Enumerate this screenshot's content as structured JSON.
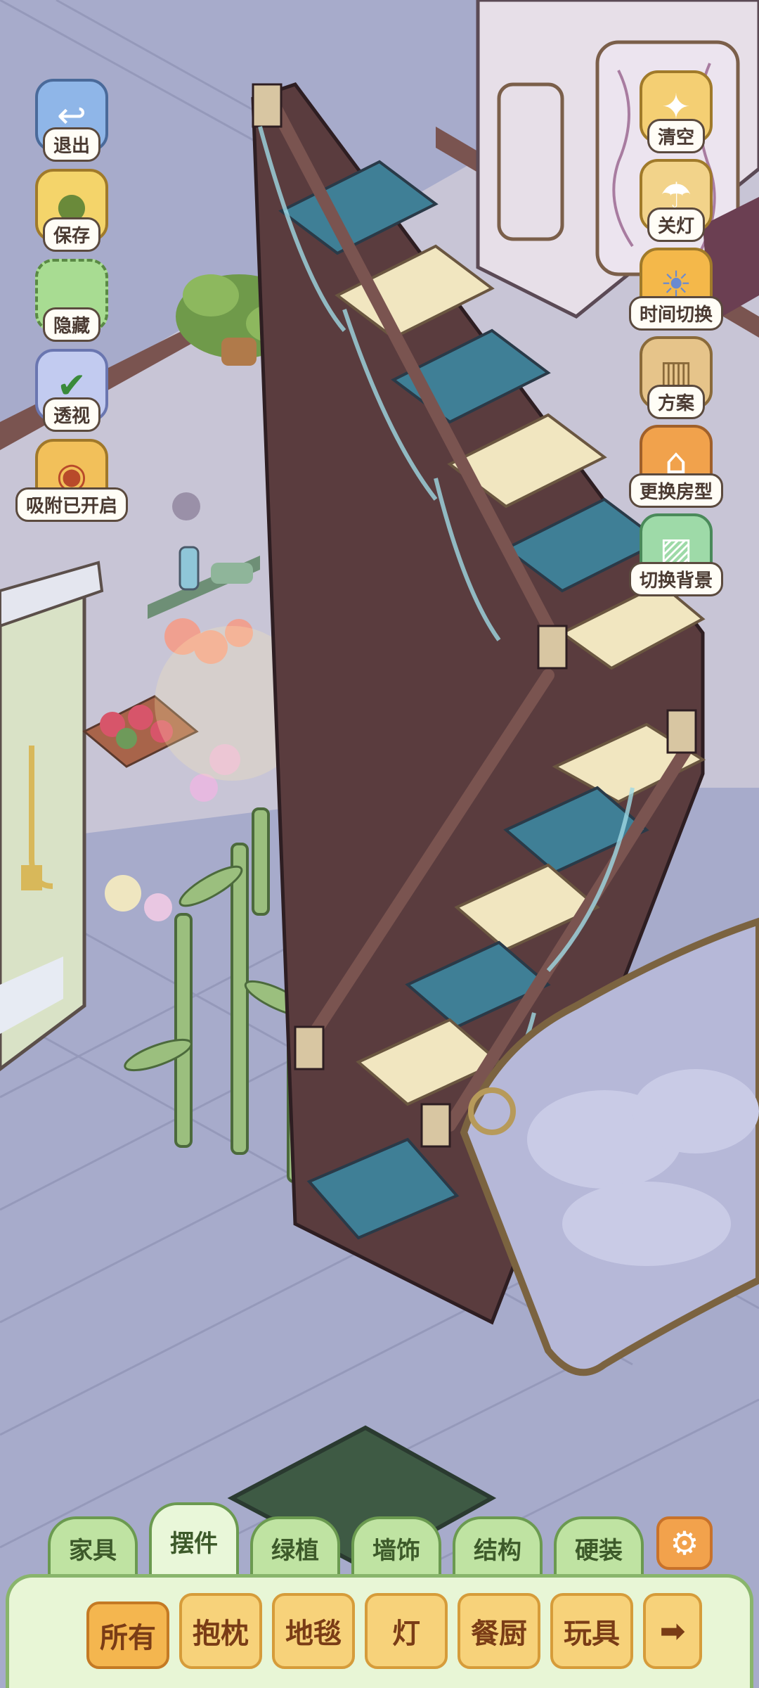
{
  "left_tools": [
    {
      "label": "退出",
      "icon": "exit-icon"
    },
    {
      "label": "保存",
      "icon": "save-icon"
    },
    {
      "label": "隐藏",
      "icon": "hide-icon"
    },
    {
      "label": "透视",
      "icon": "perspective-icon"
    },
    {
      "label": "吸附已开启",
      "icon": "snap-icon"
    }
  ],
  "right_tools": [
    {
      "label": "清空",
      "icon": "clear-icon"
    },
    {
      "label": "关灯",
      "icon": "lights-off-icon"
    },
    {
      "label": "时间切换",
      "icon": "time-switch-icon"
    },
    {
      "label": "方案",
      "icon": "plan-icon"
    },
    {
      "label": "更换房型",
      "icon": "change-room-icon"
    },
    {
      "label": "切换背景",
      "icon": "switch-background-icon"
    }
  ],
  "tabs": {
    "furniture": "家具",
    "ornaments": "摆件",
    "plants": "绿植",
    "wall_decor": "墙饰",
    "structure": "结构",
    "hardwear": "硬装",
    "active": "摆件"
  },
  "subcategories": {
    "all": "所有",
    "pillow": "抱枕",
    "rug": "地毯",
    "lamp": "灯",
    "kitchen": "餐厨",
    "toy": "玩具",
    "active": "所有"
  },
  "colors": {
    "floor": "#a7abcb",
    "wall": "#c8c5d6",
    "stair_wood": "#5a3c3e",
    "stair_blue": "#3f7f96",
    "stair_gold": "#f1e6c0",
    "tab_green": "#bfe3a2",
    "chip_yellow": "#f7d27a",
    "gear_orange": "#f2a24c"
  }
}
